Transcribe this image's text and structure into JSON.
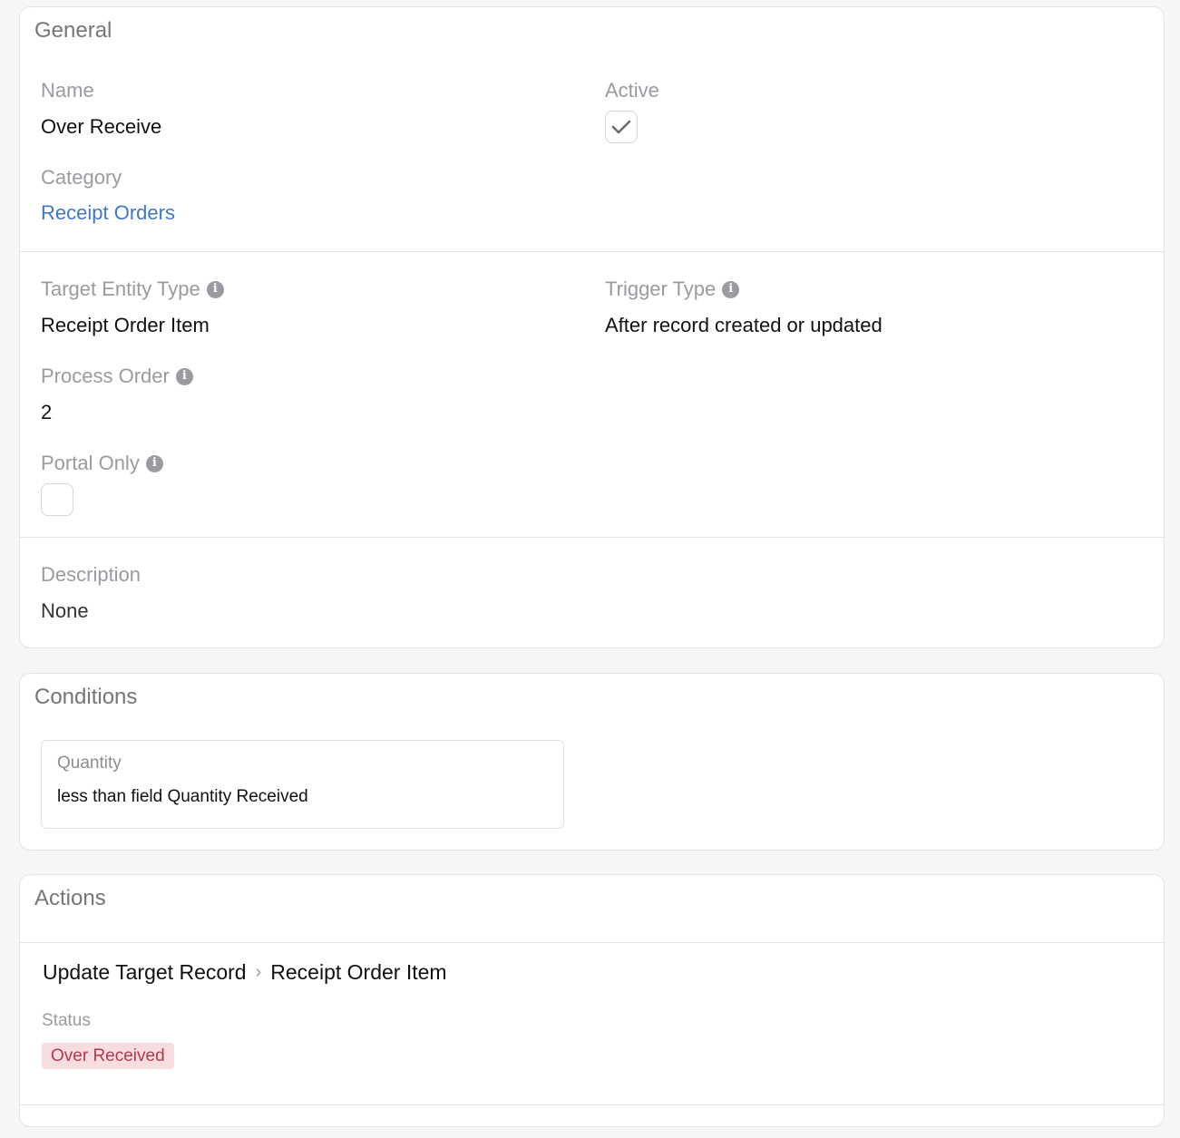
{
  "general": {
    "title": "General",
    "name_label": "Name",
    "name_value": "Over Receive",
    "active_label": "Active",
    "active_checked": true,
    "category_label": "Category",
    "category_value": "Receipt Orders",
    "target_entity_type_label": "Target Entity Type",
    "target_entity_type_value": "Receipt Order Item",
    "trigger_type_label": "Trigger Type",
    "trigger_type_value": "After record created or updated",
    "process_order_label": "Process Order",
    "process_order_value": "2",
    "portal_only_label": "Portal Only",
    "portal_only_checked": false,
    "description_label": "Description",
    "description_value": "None"
  },
  "conditions": {
    "title": "Conditions",
    "items": [
      {
        "field": "Quantity",
        "rule": "less than field Quantity Received"
      }
    ]
  },
  "actions": {
    "title": "Actions",
    "items": [
      {
        "type": "Update Target Record",
        "target": "Receipt Order Item",
        "field_label": "Status",
        "field_value": "Over Received",
        "badge_bg": "#f8dde0",
        "badge_color": "#b23a48"
      }
    ]
  },
  "colors": {
    "link": "#3f78c8",
    "label": "#9a9aa0"
  },
  "icons": {
    "info": "info-circle-icon",
    "check": "checkmark-icon",
    "chevron": "chevron-right-icon"
  }
}
